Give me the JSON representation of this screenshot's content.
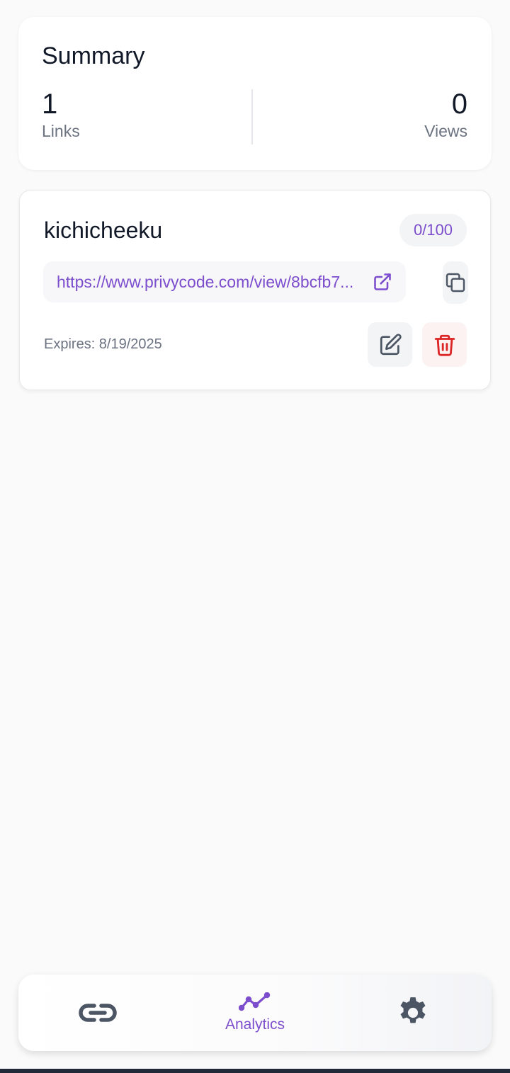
{
  "summary": {
    "title": "Summary",
    "links_value": "1",
    "links_label": "Links",
    "views_value": "0",
    "views_label": "Views"
  },
  "link_card": {
    "name": "kichicheeku",
    "views_badge": "0/100",
    "url": "https://www.privycode.com/view/8bcfb7...",
    "expires": "Expires: 8/19/2025"
  },
  "icons": {
    "open_link": "external-link-icon",
    "copy": "copy-icon",
    "edit": "edit-icon",
    "delete": "trash-icon",
    "nav_links": "link-icon",
    "nav_analytics": "analytics-icon",
    "nav_settings": "gear-icon"
  },
  "bottom_nav": {
    "analytics_label": "Analytics"
  },
  "colors": {
    "accent": "#7c4dcc",
    "danger": "#dc2626",
    "muted": "#6b7280"
  }
}
